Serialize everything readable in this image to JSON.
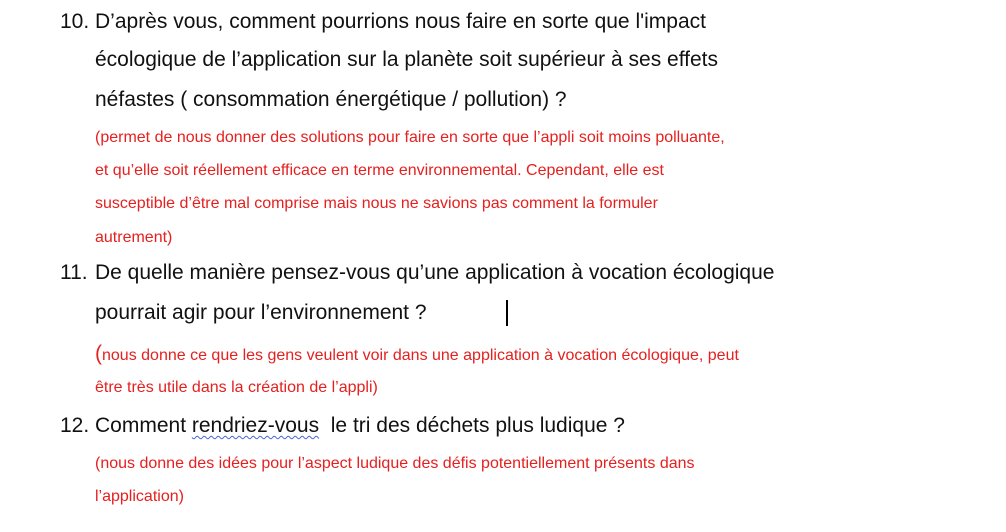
{
  "questions": [
    {
      "number": "10.",
      "lines": [
        "D’après vous, comment pourrions nous faire en sorte que l'impact",
        "écologique de l’application sur la planète soit supérieur à ses effets",
        "néfastes ( consommation énergétique / pollution) ?"
      ],
      "note_lines": [
        "(permet de nous donner des solutions pour faire en sorte que l’appli soit moins polluante,",
        "et qu’elle soit réellement efficace en terme environnemental. Cependant, elle est",
        "susceptible d’être mal comprise mais nous ne savions pas comment la formuler",
        "autrement)"
      ]
    },
    {
      "number": "11.",
      "lines": [
        "De quelle manière pensez-vous qu’une application à vocation écologique",
        "pourrait agir pour l’environnement ?"
      ],
      "note_open_paren": "(",
      "note_lines": [
        "nous donne ce que les gens veulent voir dans une application à vocation écologique, peut",
        "être très utile dans la création de l’appli)"
      ]
    },
    {
      "number": "12.",
      "line_before": "Comment ",
      "misspelled_word": "rendriez-vous",
      "line_after": "  le tri des déchets plus ludique ?",
      "note_lines": [
        "(nous donne des idées pour l’aspect ludique des défis potentiellement présents dans",
        "l’application)"
      ]
    }
  ],
  "colors": {
    "question_text": "#111111",
    "note_text": "#e5201f",
    "spellcheck_underline": "#4a63d6"
  }
}
